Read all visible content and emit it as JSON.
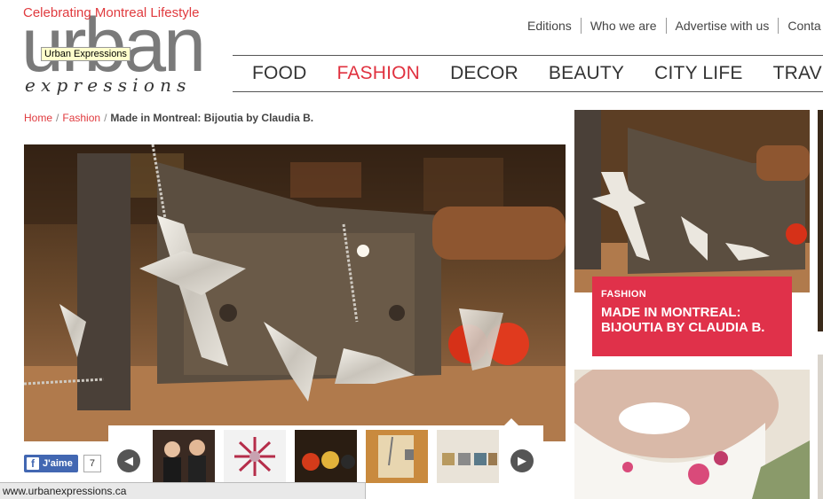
{
  "header": {
    "tagline": "Celebrating Montreal Lifestyle",
    "logo_word": "urban",
    "logo_sub": "expressions",
    "tooltip": "Urban Expressions"
  },
  "top_links": [
    "Editions",
    "Who we are",
    "Advertise with us",
    "Conta"
  ],
  "nav": {
    "items": [
      "FOOD",
      "FASHION",
      "DECOR",
      "BEAUTY",
      "CITY LIFE",
      "TRAVEL"
    ],
    "active": "FASHION",
    "active_color": "#e0313f"
  },
  "breadcrumb": {
    "home": "Home",
    "section": "Fashion",
    "current": "Made in Montreal: Bijoutia by Claudia B.",
    "separator": "/"
  },
  "gallery": {
    "prev_icon": "arrow-left-icon",
    "next_icon": "arrow-right-icon"
  },
  "like": {
    "label": "J'aime",
    "count": "7"
  },
  "side_card": {
    "category": "FASHION",
    "title": "MADE IN MONTREAL: BIJOUTIA BY CLAUDIA B.",
    "color": "#e0314a"
  },
  "status_bar": {
    "url": "www.urbanexpressions.ca"
  }
}
